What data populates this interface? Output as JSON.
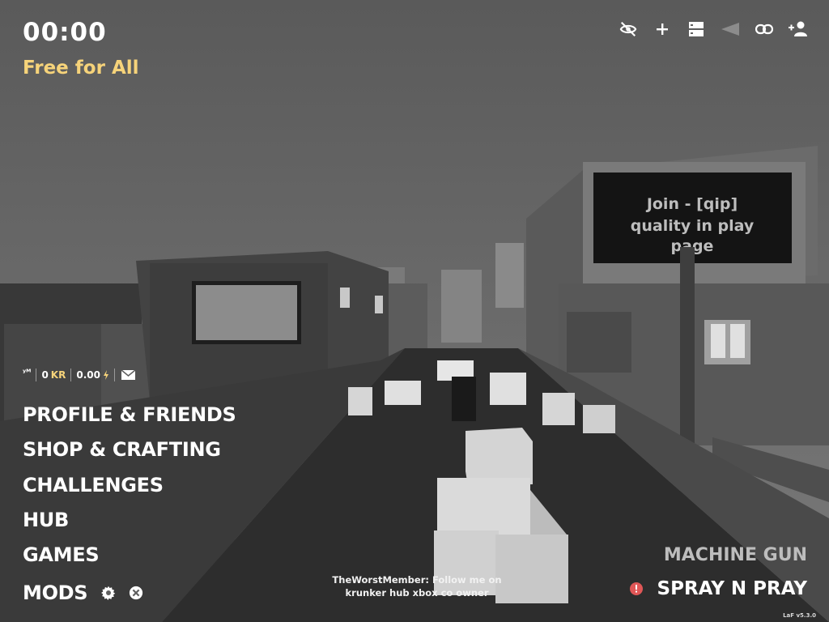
{
  "hud": {
    "timer": "00:00",
    "game_mode": "Free for All",
    "accent_color": "#f6d37a"
  },
  "top_icons": [
    {
      "name": "hide-ui-icon"
    },
    {
      "name": "add-icon"
    },
    {
      "name": "server-browser-icon"
    },
    {
      "name": "speaker-icon"
    },
    {
      "name": "invite-link-icon"
    },
    {
      "name": "add-friend-icon"
    }
  ],
  "stats": {
    "user": "ʸᴹ",
    "kr_amount": "0",
    "kr_label": "KR",
    "junk_amount": "0.00"
  },
  "menu": {
    "profile": "PROFILE & FRIENDS",
    "shop": "SHOP & CRAFTING",
    "challenges": "CHALLENGES",
    "hub": "HUB",
    "games": "GAMES",
    "mods": "MODS"
  },
  "billboard": {
    "line1": "Join - [qip]",
    "line2": "quality in play",
    "line3": "page"
  },
  "chat": {
    "message": "TheWorstMember: Follow me on krunker hub xbox co owner"
  },
  "weapons": {
    "secondary": "MACHINE GUN",
    "primary": "SPRAY N PRAY"
  },
  "version": "LaF v5.3.0"
}
